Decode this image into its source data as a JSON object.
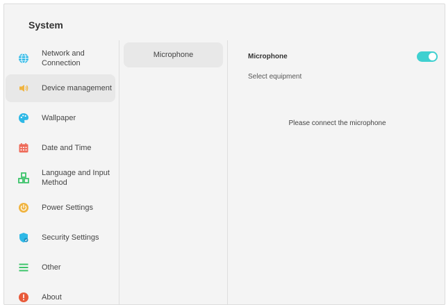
{
  "window": {
    "title": "System"
  },
  "sidebar": {
    "items": [
      {
        "label": "Network and Connection",
        "icon": "globe-icon",
        "color": "#2eb8e6",
        "active": false
      },
      {
        "label": "Device management",
        "icon": "speaker-icon",
        "color": "#f0b440",
        "active": true
      },
      {
        "label": "Wallpaper",
        "icon": "palette-icon",
        "color": "#2eb8e6",
        "active": false
      },
      {
        "label": "Date and Time",
        "icon": "calendar-icon",
        "color": "#ee6b5a",
        "active": false
      },
      {
        "label": "Language and Input Method",
        "icon": "blocks-icon",
        "color": "#3cc46a",
        "active": false
      },
      {
        "label": "Power Settings",
        "icon": "power-icon",
        "color": "#f0b440",
        "active": false
      },
      {
        "label": "Security Settings",
        "icon": "shield-icon",
        "color": "#2eb8e6",
        "active": false
      },
      {
        "label": "Other",
        "icon": "list-icon",
        "color": "#3cc46a",
        "active": false
      },
      {
        "label": "About",
        "icon": "info-icon",
        "color": "#e85a3a",
        "active": false
      }
    ]
  },
  "middle": {
    "selected_label": "Microphone"
  },
  "detail": {
    "heading": "Microphone",
    "toggle_on": true,
    "toggle_color": "#3fd0d0",
    "select_equipment_label": "Select equipment",
    "empty_message": "Please connect the microphone"
  }
}
